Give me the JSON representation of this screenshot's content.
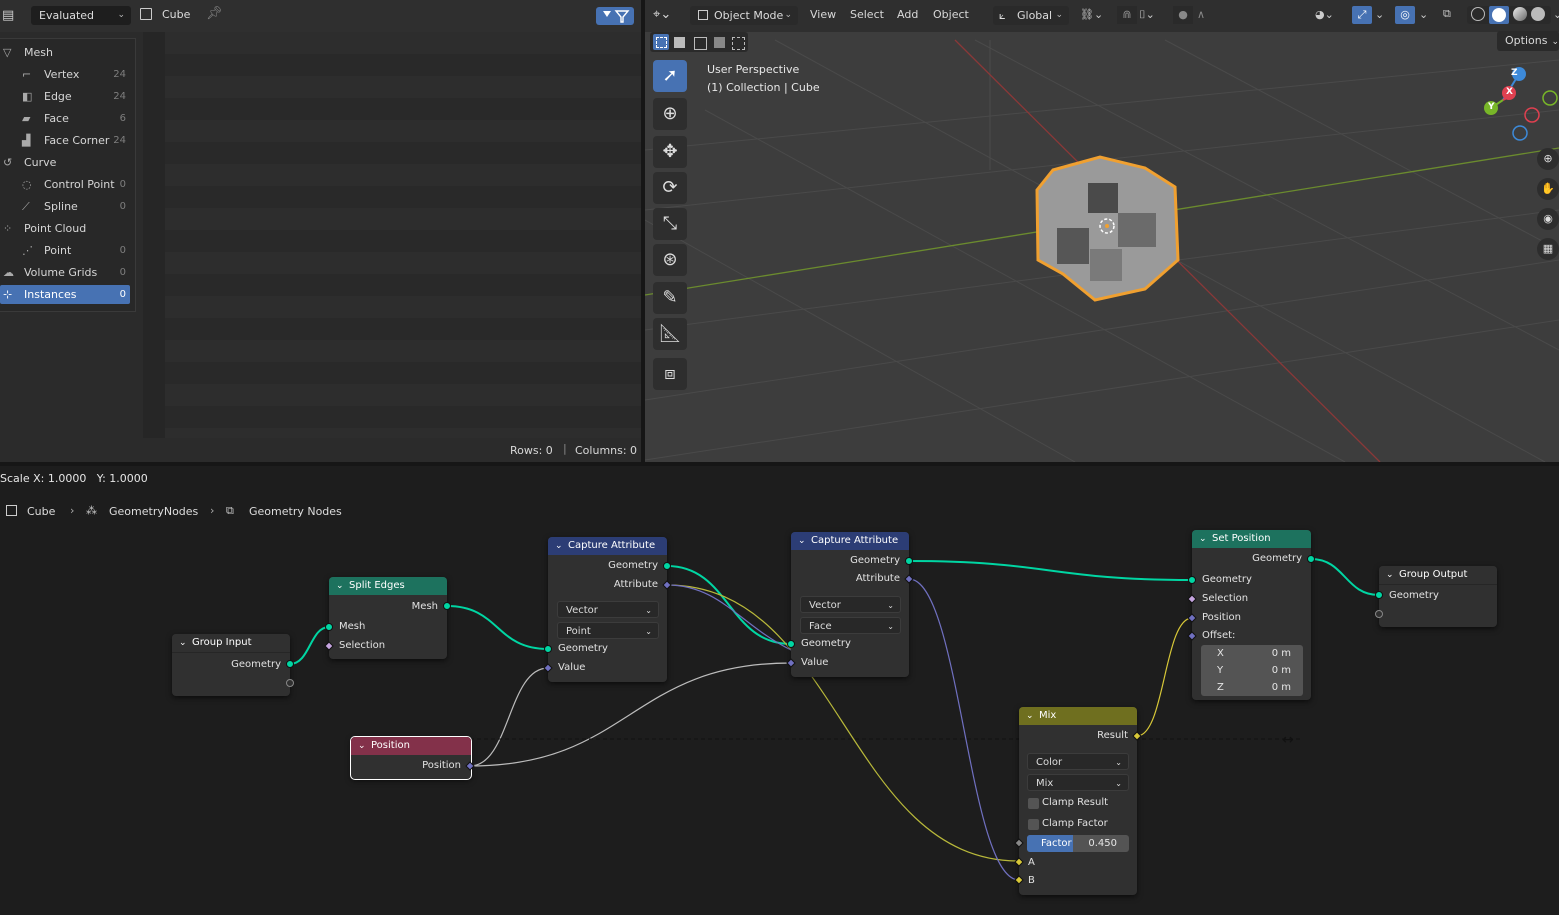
{
  "spreadsheet": {
    "mode_dropdown": "Evaluated",
    "object_name": "Cube",
    "tree": [
      {
        "label": "Mesh",
        "icon": "mesh-icon",
        "count": "",
        "indent": 0,
        "active": false
      },
      {
        "label": "Vertex",
        "icon": "vertex-icon",
        "count": "24",
        "indent": 1,
        "active": false
      },
      {
        "label": "Edge",
        "icon": "edge-icon",
        "count": "24",
        "indent": 1,
        "active": false
      },
      {
        "label": "Face",
        "icon": "face-icon",
        "count": "6",
        "indent": 1,
        "active": false
      },
      {
        "label": "Face Corner",
        "icon": "face-corner-icon",
        "count": "24",
        "indent": 1,
        "active": false
      },
      {
        "label": "Curve",
        "icon": "curve-icon",
        "count": "",
        "indent": 0,
        "active": false
      },
      {
        "label": "Control Point",
        "icon": "control-point-icon",
        "count": "0",
        "indent": 1,
        "active": false
      },
      {
        "label": "Spline",
        "icon": "spline-icon",
        "count": "0",
        "indent": 1,
        "active": false
      },
      {
        "label": "Point Cloud",
        "icon": "point-cloud-icon",
        "count": "",
        "indent": 0,
        "active": false
      },
      {
        "label": "Point",
        "icon": "point-icon",
        "count": "0",
        "indent": 1,
        "active": false
      },
      {
        "label": "Volume Grids",
        "icon": "volume-grids-icon",
        "count": "0",
        "indent": 0,
        "active": false
      },
      {
        "label": "Instances",
        "icon": "instances-icon",
        "count": "0",
        "indent": 0,
        "active": true
      }
    ],
    "rows_label": "Rows: 0",
    "columns_label": "Columns: 0"
  },
  "viewport": {
    "mode": "Object Mode",
    "menus": [
      "View",
      "Select",
      "Add",
      "Object"
    ],
    "orientation": "Global",
    "options_label": "Options",
    "overlay_line1": "User Perspective",
    "overlay_line2": "(1) Collection | Cube",
    "gizmo_axes": {
      "z": "Z",
      "y": "Y",
      "x": "X"
    },
    "accent_color": "#4772b3",
    "selection_color": "#f0a030"
  },
  "status": {
    "scale_text": "Scale X: 1.0000   Y: 1.0000"
  },
  "breadcrumb": [
    "Cube",
    "GeometryNodes",
    "Geometry Nodes"
  ],
  "nodes": {
    "group_input": {
      "title": "Group Input",
      "out_geometry": "Geometry"
    },
    "split_edges": {
      "title": "Split Edges",
      "out_mesh": "Mesh",
      "in_mesh": "Mesh",
      "in_selection": "Selection",
      "color": "#1d725e"
    },
    "capture1": {
      "title": "Capture Attribute",
      "out_geometry": "Geometry",
      "out_attribute": "Attribute",
      "type": "Vector",
      "domain": "Point",
      "in_geometry": "Geometry",
      "in_value": "Value",
      "color": "#2c3d75"
    },
    "capture2": {
      "title": "Capture Attribute",
      "out_geometry": "Geometry",
      "out_attribute": "Attribute",
      "type": "Vector",
      "domain": "Face",
      "in_geometry": "Geometry",
      "in_value": "Value",
      "color": "#2c3d75"
    },
    "set_position": {
      "title": "Set Position",
      "out_geometry": "Geometry",
      "in_geometry": "Geometry",
      "in_selection": "Selection",
      "in_position": "Position",
      "in_offset": "Offset:",
      "x_label": "X",
      "x_val": "0 m",
      "y_label": "Y",
      "y_val": "0 m",
      "z_label": "Z",
      "z_val": "0 m",
      "color": "#1d725e"
    },
    "group_output": {
      "title": "Group Output",
      "in_geometry": "Geometry"
    },
    "position": {
      "title": "Position",
      "out_position": "Position",
      "color": "#83314a"
    },
    "mix": {
      "title": "Mix",
      "out_result": "Result",
      "data_type": "Color",
      "blend": "Mix",
      "clamp_result": "Clamp Result",
      "clamp_factor": "Clamp Factor",
      "factor_label": "Factor",
      "factor_value": "0.450",
      "factor_fraction": 0.45,
      "in_a": "A",
      "in_b": "B",
      "color": "#6f6f1f"
    }
  }
}
